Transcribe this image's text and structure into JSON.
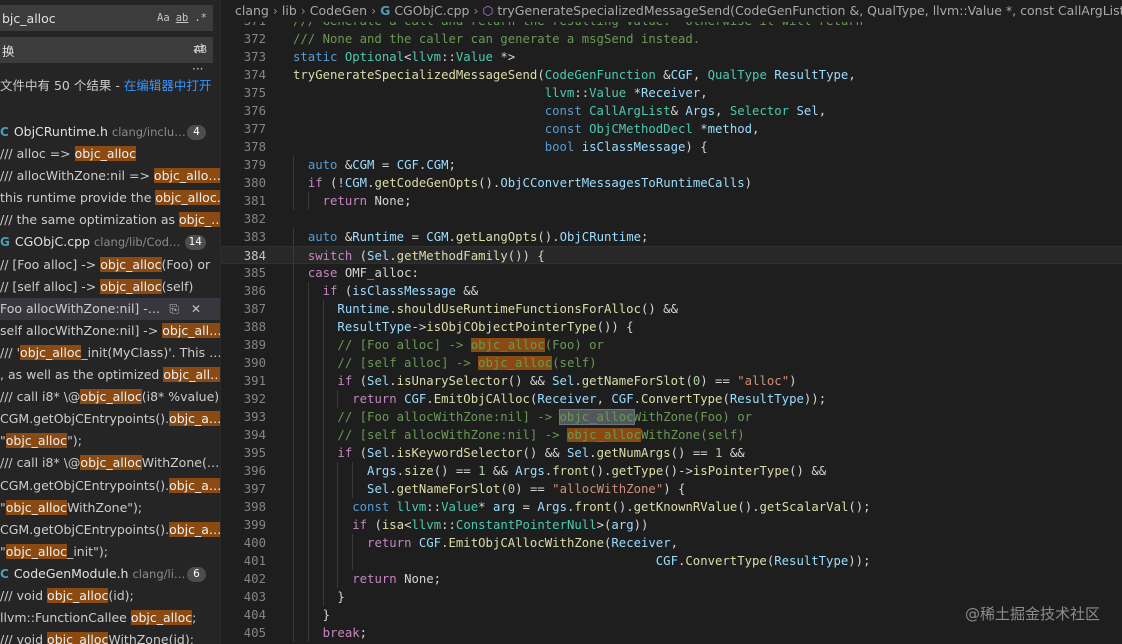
{
  "search": {
    "query": "bjc_alloc",
    "opts": [
      "Aa",
      "ab",
      ".*"
    ],
    "replace_value": "换",
    "replace_opt": "AB",
    "more": "···"
  },
  "summary": {
    "text": "文件中有 50 个结果 - ",
    "link": "在编辑器中打开"
  },
  "results": [
    {
      "type": "file",
      "name": "ObjCRuntime.h",
      "path": "clang/inclu…",
      "count": "4"
    },
    {
      "type": "line",
      "before": "///   alloc => ",
      "match": "objc_alloc",
      "after": ""
    },
    {
      "type": "line",
      "before": "///   allocWithZone:nil => ",
      "match": "objc_allo…",
      "after": ""
    },
    {
      "type": "line",
      "before": "this runtime provide the ",
      "match": "objc_alloc…",
      "after": ""
    },
    {
      "type": "line",
      "before": "/// the same optimization as ",
      "match": "objc_…",
      "after": ""
    },
    {
      "type": "file",
      "name": "CGObjC.cpp",
      "path": "clang/lib/Cod…",
      "count": "14"
    },
    {
      "type": "line",
      "before": "// [Foo alloc] -> ",
      "match": "objc_alloc",
      "after": "(Foo) or"
    },
    {
      "type": "line",
      "before": "// [self alloc] -> ",
      "match": "objc_alloc",
      "after": "(self)"
    },
    {
      "type": "line",
      "before": "Foo allocWithZone:nil] -…",
      "match": "",
      "after": "",
      "selected": true
    },
    {
      "type": "line",
      "before": "self allocWithZone:nil] -> ",
      "match": "objc_all…",
      "after": ""
    },
    {
      "type": "line",
      "before": "/// '",
      "match": "objc_alloc",
      "after": "_init(MyClass)'. This …"
    },
    {
      "type": "line",
      "before": ", as well as the optimized ",
      "match": "objc_all…",
      "after": ""
    },
    {
      "type": "line",
      "before": "///   call i8* \\@",
      "match": "objc_alloc",
      "after": "(i8* %value)"
    },
    {
      "type": "line",
      "before": "CGM.getObjCEntrypoints().",
      "match": "objc_a…",
      "after": ""
    },
    {
      "type": "line",
      "before": "\"",
      "match": "objc_alloc",
      "after": "\");"
    },
    {
      "type": "line",
      "before": "///   call i8* \\@",
      "match": "objc_alloc",
      "after": "WithZone(…"
    },
    {
      "type": "line",
      "before": "CGM.getObjCEntrypoints().",
      "match": "objc_a…",
      "after": ""
    },
    {
      "type": "line",
      "before": "\"",
      "match": "objc_alloc",
      "after": "WithZone\");"
    },
    {
      "type": "line",
      "before": "CGM.getObjCEntrypoints().",
      "match": "objc_a…",
      "after": ""
    },
    {
      "type": "line",
      "before": "\"",
      "match": "objc_alloc",
      "after": "_init\");"
    },
    {
      "type": "file",
      "name": "CodeGenModule.h",
      "path": "clang/li…",
      "count": "6"
    },
    {
      "type": "line",
      "before": "/// void ",
      "match": "objc_alloc",
      "after": "(id);"
    },
    {
      "type": "line",
      "before": "llvm::FunctionCallee ",
      "match": "objc_alloc",
      "after": ";"
    },
    {
      "type": "line",
      "before": "/// void ",
      "match": "objc_alloc",
      "after": "WithZone(id);"
    }
  ],
  "breadcrumb": {
    "parts": [
      "clang",
      "lib",
      "CodeGen",
      "CGObjC.cpp"
    ],
    "symbol": "tryGenerateSpecializedMessageSend(CodeGenFunction &, QualType, llvm::Value *, const CallArgList &, Selector, const ObjCMethodDecl *, bool)"
  },
  "current_line": "384",
  "code": [
    {
      "n": "371",
      "i": 0,
      "t": [
        [
          "cm",
          "/// Generate a call and return the resulting value.  Otherwise it will return"
        ]
      ]
    },
    {
      "n": "372",
      "i": 0,
      "t": [
        [
          "cm",
          "/// None and the caller can generate a msgSend instead."
        ]
      ]
    },
    {
      "n": "373",
      "i": 0,
      "t": [
        [
          "kw",
          "static "
        ],
        [
          "ty",
          "Optional"
        ],
        [
          "pn",
          "<"
        ],
        [
          "ty",
          "llvm"
        ],
        [
          "pn",
          "::"
        ],
        [
          "ty",
          "Value"
        ],
        [
          "pn",
          " *>"
        ]
      ]
    },
    {
      "n": "374",
      "i": 0,
      "t": [
        [
          "fn",
          "tryGenerateSpecializedMessageSend"
        ],
        [
          "pn",
          "("
        ],
        [
          "ty",
          "CodeGenFunction"
        ],
        [
          "pn",
          " &"
        ],
        [
          "vr",
          "CGF"
        ],
        [
          "pn",
          ", "
        ],
        [
          "ty",
          "QualType"
        ],
        [
          "pn",
          " "
        ],
        [
          "vr",
          "ResultType"
        ],
        [
          "pn",
          ","
        ]
      ]
    },
    {
      "n": "375",
      "i": 0,
      "pad": "                                  ",
      "t": [
        [
          "ty",
          "llvm"
        ],
        [
          "pn",
          "::"
        ],
        [
          "ty",
          "Value"
        ],
        [
          "pn",
          " *"
        ],
        [
          "vr",
          "Receiver"
        ],
        [
          "pn",
          ","
        ]
      ]
    },
    {
      "n": "376",
      "i": 0,
      "pad": "                                  ",
      "t": [
        [
          "kw",
          "const "
        ],
        [
          "ty",
          "CallArgList"
        ],
        [
          "pn",
          "& "
        ],
        [
          "vr",
          "Args"
        ],
        [
          "pn",
          ", "
        ],
        [
          "ty",
          "Selector"
        ],
        [
          "pn",
          " "
        ],
        [
          "vr",
          "Sel"
        ],
        [
          "pn",
          ","
        ]
      ]
    },
    {
      "n": "377",
      "i": 0,
      "pad": "                                  ",
      "t": [
        [
          "kw",
          "const "
        ],
        [
          "ty",
          "ObjCMethodDecl"
        ],
        [
          "pn",
          " *"
        ],
        [
          "vr",
          "method"
        ],
        [
          "pn",
          ","
        ]
      ]
    },
    {
      "n": "378",
      "i": 0,
      "pad": "                                  ",
      "t": [
        [
          "kw",
          "bool "
        ],
        [
          "vr",
          "isClassMessage"
        ],
        [
          "pn",
          ") {"
        ]
      ]
    },
    {
      "n": "379",
      "i": 1,
      "t": [
        [
          "kw",
          "auto "
        ],
        [
          "pn",
          "&"
        ],
        [
          "vr",
          "CGM"
        ],
        [
          "pn",
          " = "
        ],
        [
          "vr",
          "CGF"
        ],
        [
          "pn",
          "."
        ],
        [
          "vr",
          "CGM"
        ],
        [
          "pn",
          ";"
        ]
      ]
    },
    {
      "n": "380",
      "i": 1,
      "t": [
        [
          "ck",
          "if "
        ],
        [
          "pn",
          "(!"
        ],
        [
          "vr",
          "CGM"
        ],
        [
          "pn",
          "."
        ],
        [
          "fn",
          "getCodeGenOpts"
        ],
        [
          "pn",
          "()."
        ],
        [
          "vr",
          "ObjCConvertMessagesToRuntimeCalls"
        ],
        [
          "pn",
          ")"
        ]
      ]
    },
    {
      "n": "381",
      "i": 2,
      "t": [
        [
          "ck",
          "return "
        ],
        [
          "pn",
          "None;"
        ]
      ]
    },
    {
      "n": "382",
      "i": 0,
      "t": []
    },
    {
      "n": "383",
      "i": 1,
      "t": [
        [
          "kw",
          "auto "
        ],
        [
          "pn",
          "&"
        ],
        [
          "vr",
          "Runtime"
        ],
        [
          "pn",
          " = "
        ],
        [
          "vr",
          "CGM"
        ],
        [
          "pn",
          "."
        ],
        [
          "fn",
          "getLangOpts"
        ],
        [
          "pn",
          "()."
        ],
        [
          "vr",
          "ObjCRuntime"
        ],
        [
          "pn",
          ";"
        ]
      ]
    },
    {
      "n": "384",
      "i": 1,
      "t": [
        [
          "ck",
          "switch "
        ],
        [
          "pn",
          "("
        ],
        [
          "vr",
          "Sel"
        ],
        [
          "pn",
          "."
        ],
        [
          "fn",
          "getMethodFamily"
        ],
        [
          "pn",
          "()) {"
        ]
      ]
    },
    {
      "n": "385",
      "i": 1,
      "t": [
        [
          "ck",
          "case "
        ],
        [
          "pn",
          "OMF_alloc:"
        ]
      ]
    },
    {
      "n": "386",
      "i": 2,
      "t": [
        [
          "ck",
          "if "
        ],
        [
          "pn",
          "("
        ],
        [
          "vr",
          "isClassMessage"
        ],
        [
          "pn",
          " &&"
        ]
      ]
    },
    {
      "n": "387",
      "i": 3,
      "t": [
        [
          "vr",
          "Runtime"
        ],
        [
          "pn",
          "."
        ],
        [
          "fn",
          "shouldUseRuntimeFunctionsForAlloc"
        ],
        [
          "pn",
          "() &&"
        ]
      ]
    },
    {
      "n": "388",
      "i": 3,
      "t": [
        [
          "vr",
          "ResultType"
        ],
        [
          "pn",
          "->"
        ],
        [
          "fn",
          "isObjCObjectPointerType"
        ],
        [
          "pn",
          "()) {"
        ]
      ]
    },
    {
      "n": "389",
      "i": 3,
      "t": [
        [
          "cm",
          "// [Foo alloc] -> "
        ],
        [
          "mk",
          "objc_alloc"
        ],
        [
          "cm",
          "(Foo) or"
        ]
      ]
    },
    {
      "n": "390",
      "i": 3,
      "t": [
        [
          "cm",
          "// [self alloc] -> "
        ],
        [
          "mk",
          "objc_alloc"
        ],
        [
          "cm",
          "(self)"
        ]
      ]
    },
    {
      "n": "391",
      "i": 3,
      "t": [
        [
          "ck",
          "if "
        ],
        [
          "pn",
          "("
        ],
        [
          "vr",
          "Sel"
        ],
        [
          "pn",
          "."
        ],
        [
          "fn",
          "isUnarySelector"
        ],
        [
          "pn",
          "() && "
        ],
        [
          "vr",
          "Sel"
        ],
        [
          "pn",
          "."
        ],
        [
          "fn",
          "getNameForSlot"
        ],
        [
          "pn",
          "("
        ],
        [
          "nu",
          "0"
        ],
        [
          "pn",
          ") == "
        ],
        [
          "st",
          "\"alloc\""
        ],
        [
          "pn",
          ")"
        ]
      ]
    },
    {
      "n": "392",
      "i": 4,
      "t": [
        [
          "ck",
          "return "
        ],
        [
          "vr",
          "CGF"
        ],
        [
          "pn",
          "."
        ],
        [
          "fn",
          "EmitObjCAlloc"
        ],
        [
          "pn",
          "("
        ],
        [
          "vr",
          "Receiver"
        ],
        [
          "pn",
          ", "
        ],
        [
          "vr",
          "CGF"
        ],
        [
          "pn",
          "."
        ],
        [
          "fn",
          "ConvertType"
        ],
        [
          "pn",
          "("
        ],
        [
          "vr",
          "ResultType"
        ],
        [
          "pn",
          "));"
        ]
      ]
    },
    {
      "n": "393",
      "i": 3,
      "t": [
        [
          "cm",
          "// [Foo allocWithZone:nil] -> "
        ],
        [
          "mk2",
          "objc_alloc"
        ],
        [
          "cm",
          "WithZone(Foo) or"
        ]
      ]
    },
    {
      "n": "394",
      "i": 3,
      "t": [
        [
          "cm",
          "// [self allocWithZone:nil] -> "
        ],
        [
          "mk",
          "objc_alloc"
        ],
        [
          "cm",
          "WithZone(self)"
        ]
      ]
    },
    {
      "n": "395",
      "i": 3,
      "t": [
        [
          "ck",
          "if "
        ],
        [
          "pn",
          "("
        ],
        [
          "vr",
          "Sel"
        ],
        [
          "pn",
          "."
        ],
        [
          "fn",
          "isKeywordSelector"
        ],
        [
          "pn",
          "() && "
        ],
        [
          "vr",
          "Sel"
        ],
        [
          "pn",
          "."
        ],
        [
          "fn",
          "getNumArgs"
        ],
        [
          "pn",
          "() == "
        ],
        [
          "nu",
          "1"
        ],
        [
          "pn",
          " &&"
        ]
      ]
    },
    {
      "n": "396",
      "i": 5,
      "t": [
        [
          "vr",
          "Args"
        ],
        [
          "pn",
          "."
        ],
        [
          "fn",
          "size"
        ],
        [
          "pn",
          "() == "
        ],
        [
          "nu",
          "1"
        ],
        [
          "pn",
          " && "
        ],
        [
          "vr",
          "Args"
        ],
        [
          "pn",
          "."
        ],
        [
          "fn",
          "front"
        ],
        [
          "pn",
          "()."
        ],
        [
          "fn",
          "getType"
        ],
        [
          "pn",
          "()->"
        ],
        [
          "fn",
          "isPointerType"
        ],
        [
          "pn",
          "() &&"
        ]
      ]
    },
    {
      "n": "397",
      "i": 5,
      "t": [
        [
          "vr",
          "Sel"
        ],
        [
          "pn",
          "."
        ],
        [
          "fn",
          "getNameForSlot"
        ],
        [
          "pn",
          "("
        ],
        [
          "nu",
          "0"
        ],
        [
          "pn",
          ") == "
        ],
        [
          "st",
          "\"allocWithZone\""
        ],
        [
          "pn",
          ") {"
        ]
      ]
    },
    {
      "n": "398",
      "i": 4,
      "t": [
        [
          "kw",
          "const "
        ],
        [
          "ty",
          "llvm"
        ],
        [
          "pn",
          "::"
        ],
        [
          "ty",
          "Value"
        ],
        [
          "pn",
          "* "
        ],
        [
          "vr",
          "arg"
        ],
        [
          "pn",
          " = "
        ],
        [
          "vr",
          "Args"
        ],
        [
          "pn",
          "."
        ],
        [
          "fn",
          "front"
        ],
        [
          "pn",
          "()."
        ],
        [
          "fn",
          "getKnownRValue"
        ],
        [
          "pn",
          "()."
        ],
        [
          "fn",
          "getScalarVal"
        ],
        [
          "pn",
          "();"
        ]
      ]
    },
    {
      "n": "399",
      "i": 4,
      "t": [
        [
          "ck",
          "if "
        ],
        [
          "pn",
          "("
        ],
        [
          "fn",
          "isa"
        ],
        [
          "pn",
          "<"
        ],
        [
          "ty",
          "llvm"
        ],
        [
          "pn",
          "::"
        ],
        [
          "ty",
          "ConstantPointerNull"
        ],
        [
          "pn",
          ">("
        ],
        [
          "vr",
          "arg"
        ],
        [
          "pn",
          "))"
        ]
      ]
    },
    {
      "n": "400",
      "i": 5,
      "t": [
        [
          "ck",
          "return "
        ],
        [
          "vr",
          "CGF"
        ],
        [
          "pn",
          "."
        ],
        [
          "fn",
          "EmitObjCAllocWithZone"
        ],
        [
          "pn",
          "("
        ],
        [
          "vr",
          "Receiver"
        ],
        [
          "pn",
          ","
        ]
      ]
    },
    {
      "n": "401",
      "i": 5,
      "pad": "                                       ",
      "t": [
        [
          "vr",
          "CGF"
        ],
        [
          "pn",
          "."
        ],
        [
          "fn",
          "ConvertType"
        ],
        [
          "pn",
          "("
        ],
        [
          "vr",
          "ResultType"
        ],
        [
          "pn",
          "));"
        ]
      ]
    },
    {
      "n": "402",
      "i": 4,
      "t": [
        [
          "ck",
          "return "
        ],
        [
          "pn",
          "None;"
        ]
      ]
    },
    {
      "n": "403",
      "i": 3,
      "t": [
        [
          "pn",
          "}"
        ]
      ]
    },
    {
      "n": "404",
      "i": 2,
      "t": [
        [
          "pn",
          "}"
        ]
      ]
    },
    {
      "n": "405",
      "i": 2,
      "t": [
        [
          "ck",
          "break"
        ],
        [
          "pn",
          ";"
        ]
      ]
    }
  ],
  "watermark": "@稀土掘金技术社区"
}
